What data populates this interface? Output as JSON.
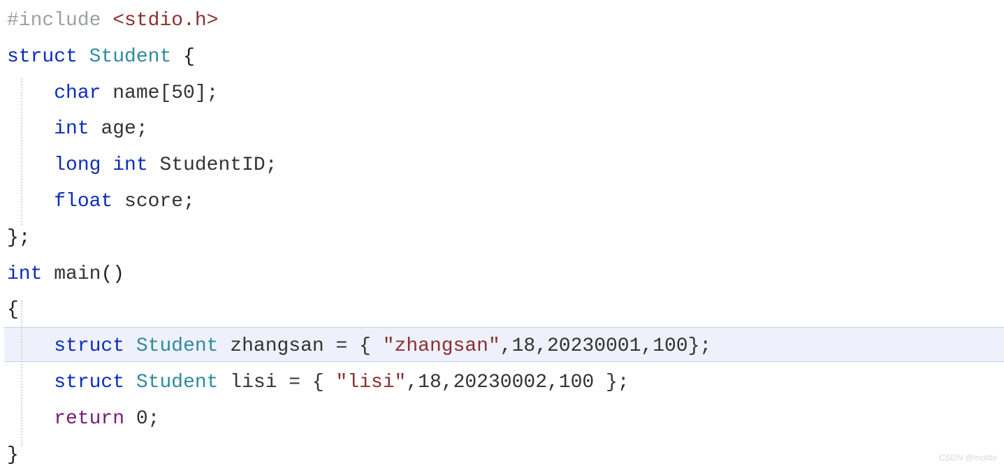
{
  "code": {
    "l1": {
      "hash": "#",
      "include": "include ",
      "header": "<stdio.h>"
    },
    "l2": {
      "struct": "struct",
      "sp": " ",
      "type": "Student",
      "sp2": " ",
      "brace": "{"
    },
    "l3": {
      "indent": "    ",
      "kw": "char",
      "rest": " name[50];"
    },
    "l4": {
      "indent": "    ",
      "kw": "int",
      "rest": " age;"
    },
    "l5": {
      "indent": "    ",
      "kw1": "long",
      "sp": " ",
      "kw2": "int",
      "rest": " StudentID;"
    },
    "l6": {
      "indent": "    ",
      "kw": "float",
      "rest": " score;"
    },
    "l7": {
      "text": "};"
    },
    "l8": {
      "kw": "int",
      "sp": " ",
      "fn": "main",
      "paren": "()"
    },
    "l9": {
      "text": "{"
    },
    "l10": {
      "indent": "    ",
      "kw": "struct",
      "sp": " ",
      "type": "Student",
      "sp2": " ",
      "var": "zhangsan = { ",
      "str": "\"zhangsan\"",
      "rest": ",18,20230001,100};"
    },
    "l11": {
      "indent": "    ",
      "kw": "struct",
      "sp": " ",
      "type": "Student",
      "sp2": " ",
      "var": "lisi = { ",
      "str": "\"lisi\"",
      "rest": ",18,20230002,100 };"
    },
    "l12": {
      "indent": "    ",
      "kw": "return",
      "rest": " 0;"
    },
    "l13": {
      "text": "}"
    }
  },
  "watermark": "CSDN @mottte"
}
